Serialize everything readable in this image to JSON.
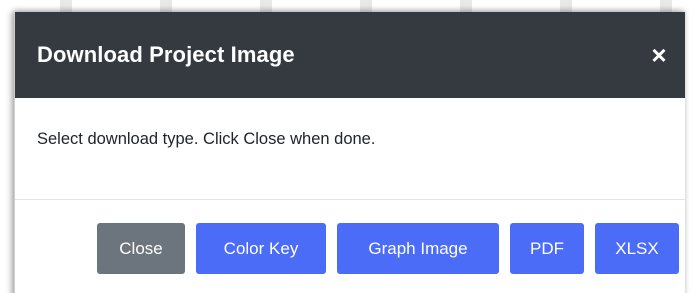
{
  "modal": {
    "title": "Download Project Image",
    "close_symbol": "×",
    "message": "Select download type. Click Close when done.",
    "buttons": [
      {
        "label": "Close",
        "style": "secondary"
      },
      {
        "label": "Color Key",
        "style": "primary"
      },
      {
        "label": "Graph Image",
        "style": "primary"
      },
      {
        "label": "PDF",
        "style": "primary"
      },
      {
        "label": "XLSX",
        "style": "primary"
      }
    ]
  },
  "colors": {
    "header_bg": "#343a40",
    "primary": "#4b6cf7",
    "secondary": "#6c757d"
  },
  "icons": {
    "header_close": "close-icon"
  }
}
